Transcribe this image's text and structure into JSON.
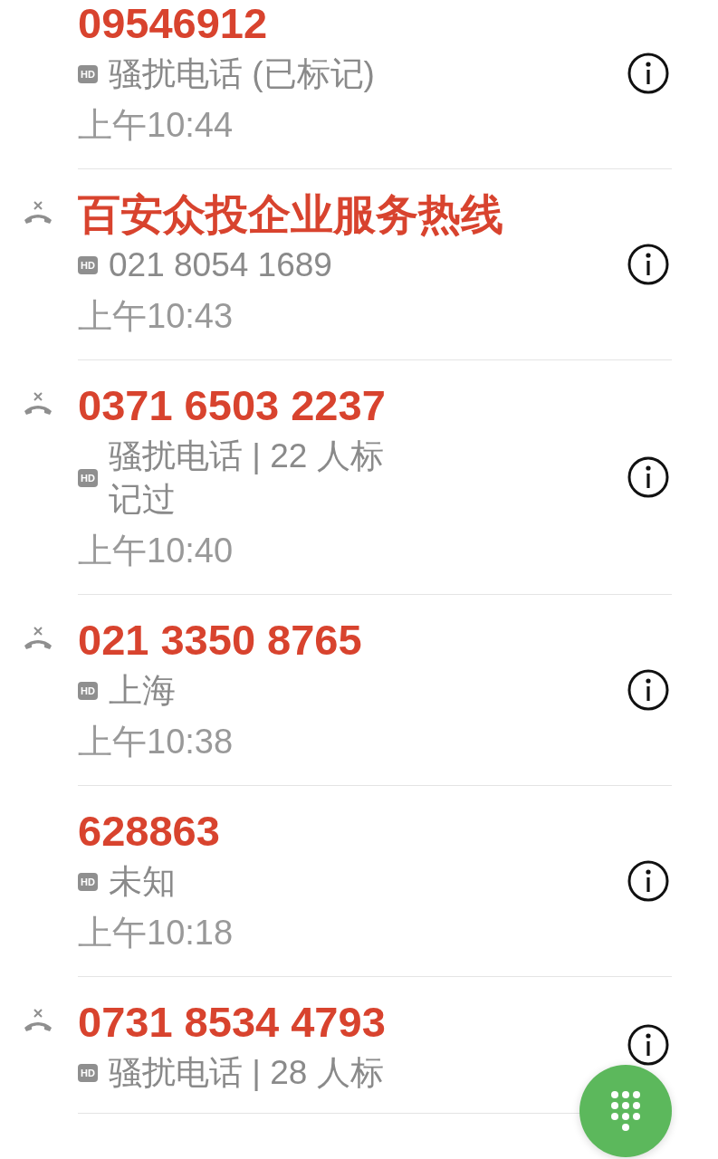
{
  "calls": [
    {
      "name": "09546912",
      "missed": false,
      "badge": "HD",
      "detail": "骚扰电话 (已标记)",
      "time": "上午10:44"
    },
    {
      "name": "百安众投企业服务热线",
      "missed": true,
      "badge": "HD",
      "detail": "021 8054 1689",
      "time": "上午10:43"
    },
    {
      "name": "0371 6503 2237",
      "missed": true,
      "badge": "HD",
      "detail": "骚扰电话 | 22 人标记过",
      "time": "上午10:40"
    },
    {
      "name": "021 3350 8765",
      "missed": true,
      "badge": "HD",
      "detail": "上海",
      "time": "上午10:38"
    },
    {
      "name": "628863",
      "missed": false,
      "badge": "HD",
      "detail": "未知",
      "time": "上午10:18"
    },
    {
      "name": "0731 8534 4793",
      "missed": true,
      "badge": "HD",
      "detail": "骚扰电话 | 28 人标"
    }
  ]
}
